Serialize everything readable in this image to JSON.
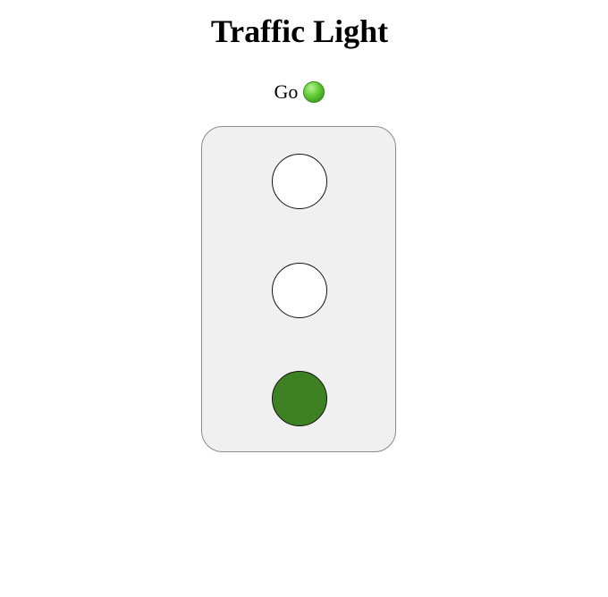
{
  "page": {
    "title": "Traffic Light"
  },
  "status": {
    "label": "Go",
    "icon": "green-circle-icon",
    "icon_color": "#4caf2f"
  },
  "traffic_light": {
    "housing_color": "#f0f0f0",
    "active_lamp": "green",
    "lamps": [
      {
        "name": "red",
        "on": false,
        "on_color": "#d32f2f",
        "off_color": "#ffffff"
      },
      {
        "name": "yellow",
        "on": false,
        "on_color": "#f2c200",
        "off_color": "#ffffff"
      },
      {
        "name": "green",
        "on": true,
        "on_color": "#3d8124",
        "off_color": "#ffffff"
      }
    ]
  }
}
